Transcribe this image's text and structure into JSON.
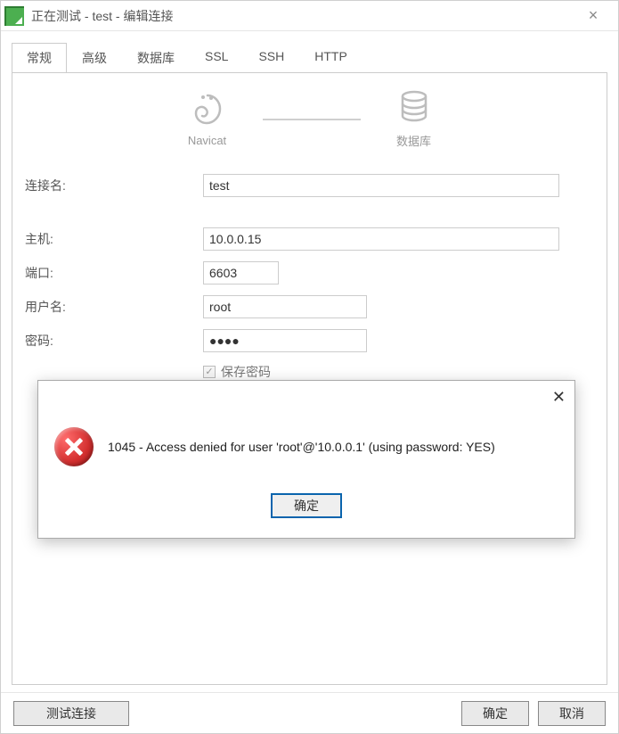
{
  "window": {
    "title": "正在测试 - test - 编辑连接"
  },
  "tabs": {
    "general": "常规",
    "advanced": "高级",
    "database": "数据库",
    "ssl": "SSL",
    "ssh": "SSH",
    "http": "HTTP",
    "active": "general"
  },
  "diagram": {
    "left_label": "Navicat",
    "right_label": "数据库"
  },
  "form": {
    "connection_name_label": "连接名:",
    "connection_name_value": "test",
    "host_label": "主机:",
    "host_value": "10.0.0.15",
    "port_label": "端口:",
    "port_value": "6603",
    "user_label": "用户名:",
    "user_value": "root",
    "password_label": "密码:",
    "password_value": "●●●●",
    "save_password_label": "保存密码",
    "save_password_checked": true
  },
  "modal": {
    "message": "1045 - Access denied for user 'root'@'10.0.0.1' (using password: YES)",
    "ok_label": "确定"
  },
  "footer": {
    "test_label": "测试连接",
    "ok_label": "确定",
    "cancel_label": "取消"
  }
}
